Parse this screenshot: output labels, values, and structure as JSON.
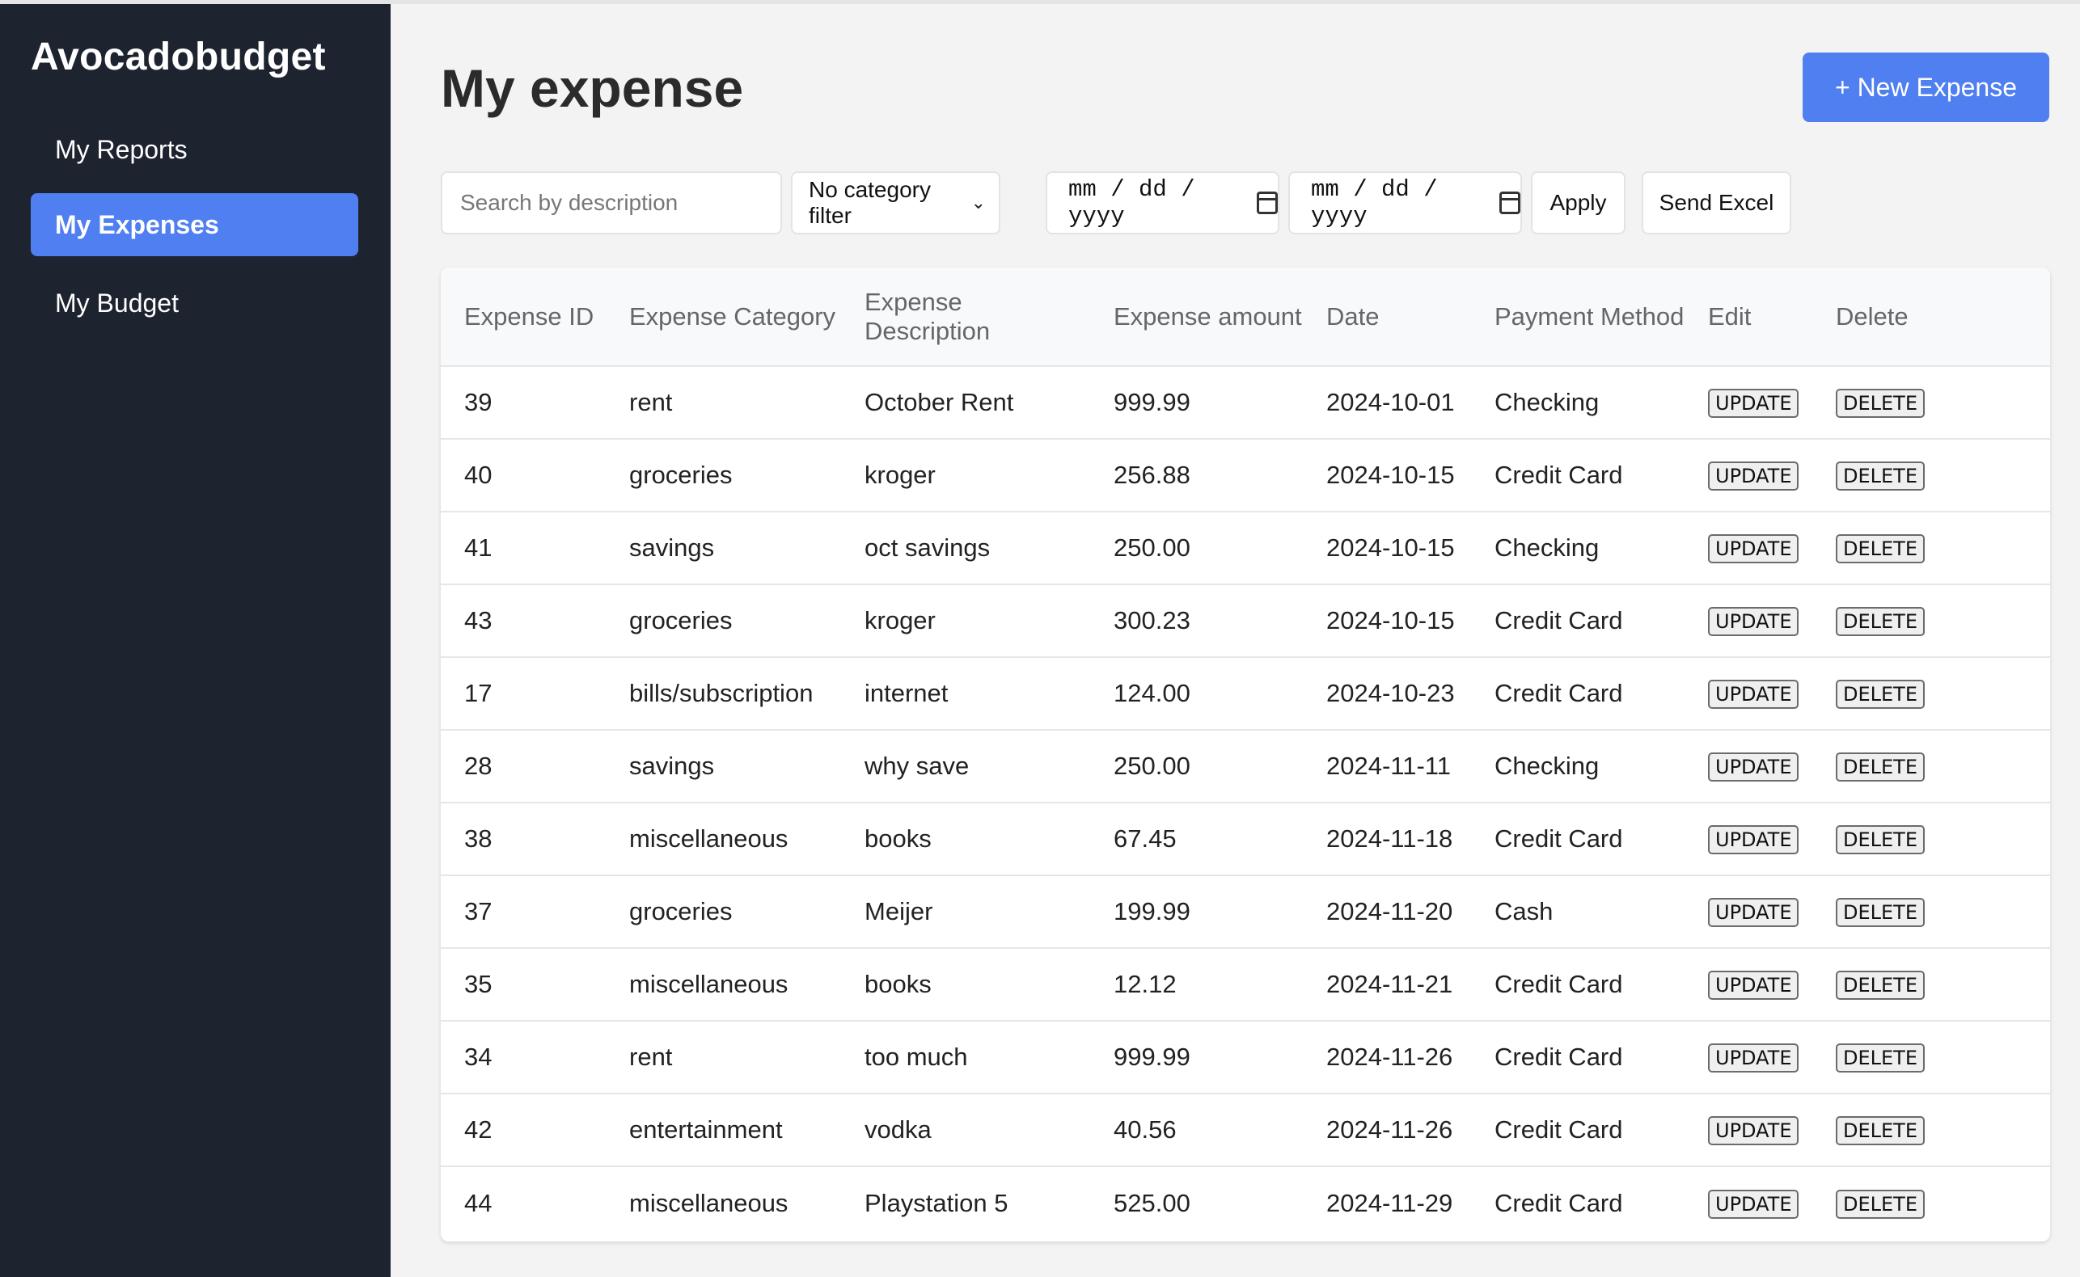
{
  "sidebar": {
    "brand": "Avocadobudget",
    "items": [
      {
        "label": "My Reports",
        "active": false
      },
      {
        "label": "My Expenses",
        "active": true
      },
      {
        "label": "My Budget",
        "active": false
      }
    ]
  },
  "header": {
    "title": "My expense",
    "new_button": "+ New Expense"
  },
  "filters": {
    "search_placeholder": "Search by description",
    "category_select": "No category filter",
    "date_from": "mm / dd / yyyy",
    "date_to": "mm / dd / yyyy",
    "apply_label": "Apply",
    "excel_label": "Send Excel"
  },
  "table": {
    "headers": [
      "Expense ID",
      "Expense Category",
      "Expense Description",
      "Expense amount",
      "Date",
      "Payment Method",
      "Edit",
      "Delete"
    ],
    "update_label": "UPDATE",
    "delete_label": "DELETE",
    "rows": [
      {
        "id": "39",
        "category": "rent",
        "description": "October Rent",
        "amount": "999.99",
        "date": "2024-10-01",
        "payment": "Checking"
      },
      {
        "id": "40",
        "category": "groceries",
        "description": "kroger",
        "amount": "256.88",
        "date": "2024-10-15",
        "payment": "Credit Card"
      },
      {
        "id": "41",
        "category": "savings",
        "description": "oct savings",
        "amount": "250.00",
        "date": "2024-10-15",
        "payment": "Checking"
      },
      {
        "id": "43",
        "category": "groceries",
        "description": "kroger",
        "amount": "300.23",
        "date": "2024-10-15",
        "payment": "Credit Card"
      },
      {
        "id": "17",
        "category": "bills/subscription",
        "description": "internet",
        "amount": "124.00",
        "date": "2024-10-23",
        "payment": "Credit Card"
      },
      {
        "id": "28",
        "category": "savings",
        "description": "why save",
        "amount": "250.00",
        "date": "2024-11-11",
        "payment": "Checking"
      },
      {
        "id": "38",
        "category": "miscellaneous",
        "description": "books",
        "amount": "67.45",
        "date": "2024-11-18",
        "payment": "Credit Card"
      },
      {
        "id": "37",
        "category": "groceries",
        "description": "Meijer",
        "amount": "199.99",
        "date": "2024-11-20",
        "payment": "Cash"
      },
      {
        "id": "35",
        "category": "miscellaneous",
        "description": "books",
        "amount": "12.12",
        "date": "2024-11-21",
        "payment": "Credit Card"
      },
      {
        "id": "34",
        "category": "rent",
        "description": "too much",
        "amount": "999.99",
        "date": "2024-11-26",
        "payment": "Credit Card"
      },
      {
        "id": "42",
        "category": "entertainment",
        "description": "vodka",
        "amount": "40.56",
        "date": "2024-11-26",
        "payment": "Credit Card"
      },
      {
        "id": "44",
        "category": "miscellaneous",
        "description": "Playstation 5",
        "amount": "525.00",
        "date": "2024-11-29",
        "payment": "Credit Card"
      }
    ]
  },
  "colors": {
    "sidebar_bg": "#1e2330",
    "accent": "#4f7ff0",
    "page_bg": "#f3f3f3"
  }
}
